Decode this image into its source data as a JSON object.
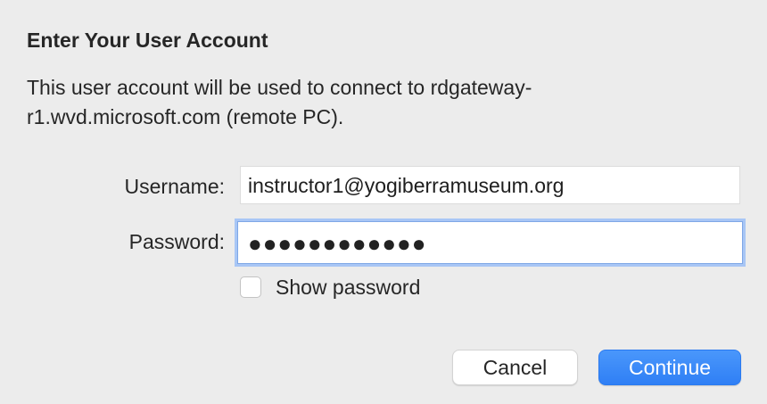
{
  "dialog": {
    "title": "Enter Your User Account",
    "message_line1": "This user account will be used to connect to rdgateway-",
    "message_line2": "r1.wvd.microsoft.com (remote PC)."
  },
  "form": {
    "username_label": "Username:",
    "username_value": "instructor1@yogiberramuseum.org",
    "password_label": "Password:",
    "password_value": "●●●●●●●●●●●●",
    "show_password_label": "Show password",
    "show_password_checked": false
  },
  "buttons": {
    "cancel_label": "Cancel",
    "continue_label": "Continue"
  },
  "colors": {
    "accent": "#3585f7",
    "focus_ring": "#a8c6f5",
    "background": "#ececec"
  }
}
